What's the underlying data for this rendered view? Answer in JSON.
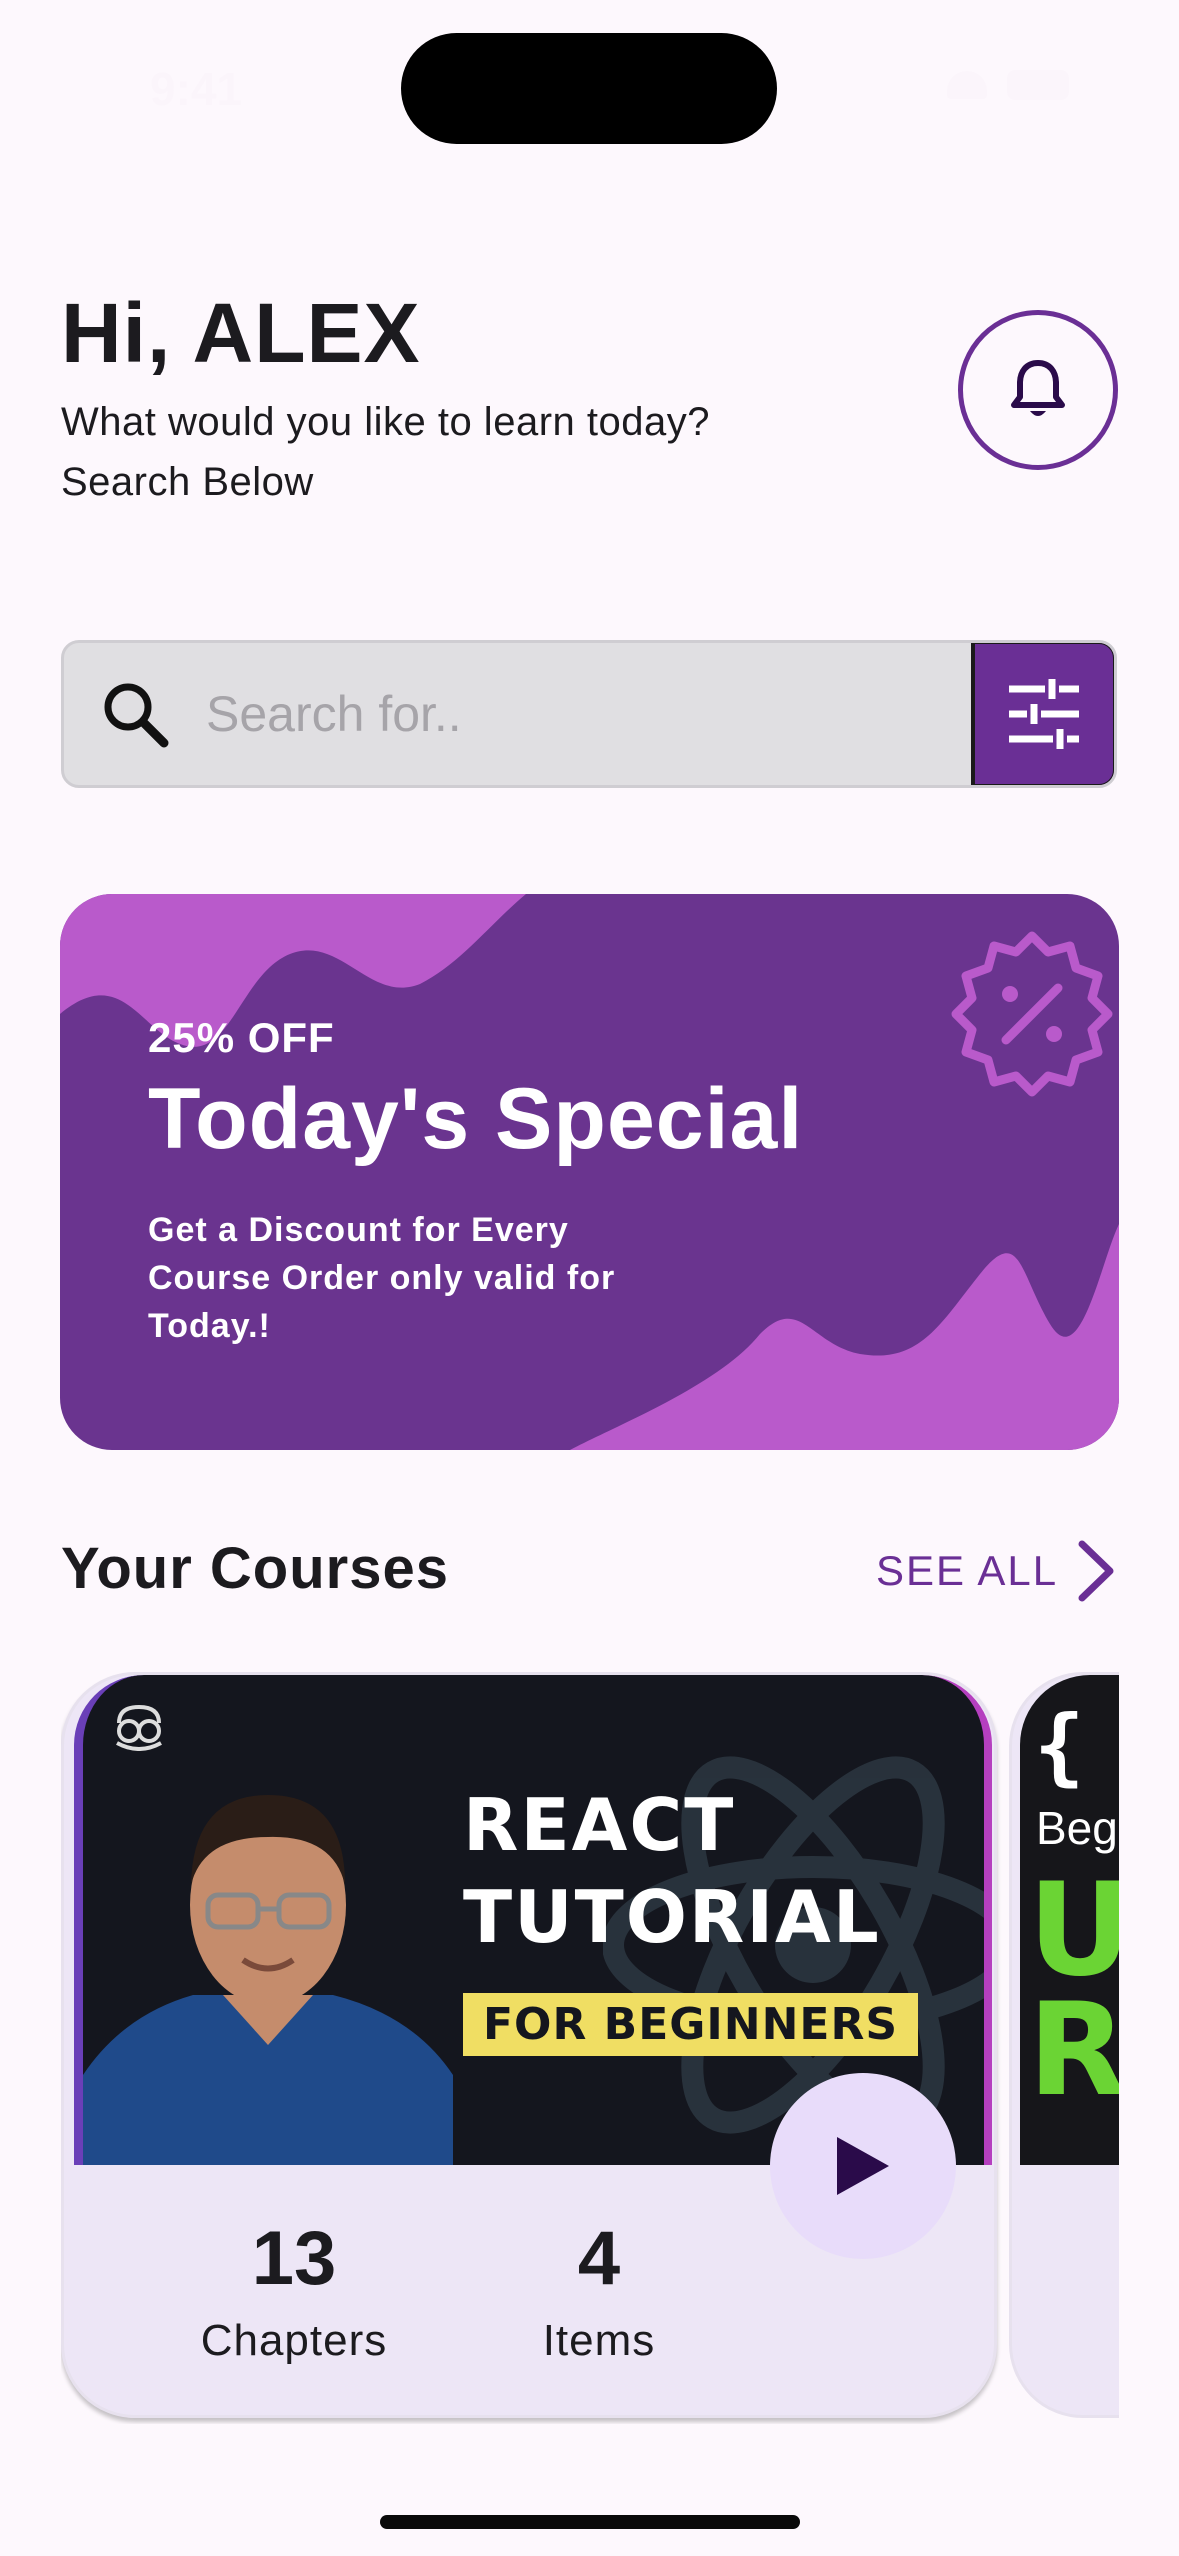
{
  "status_bar": {
    "time": "9:41"
  },
  "header": {
    "greeting": "Hi, ALEX",
    "subtitle_line1": "What would you like to learn today?",
    "subtitle_line2": "Search Below"
  },
  "search": {
    "placeholder": "Search for.."
  },
  "promo": {
    "badge": "25% OFF",
    "title": "Today's Special",
    "description": "Get a Discount for Every Course Order only valid for Today.!",
    "colors": {
      "background": "#6a348f",
      "wave": "#b95acb"
    }
  },
  "courses_section": {
    "title": "Your Courses",
    "see_all_label": "SEE ALL"
  },
  "courses": [
    {
      "thumbnail_line1": "REACT",
      "thumbnail_line2": "TUTORIAL",
      "thumbnail_tag": "FOR BEGINNERS",
      "chapters_value": "13",
      "chapters_label": "Chapters",
      "items_value": "4",
      "items_label": "Items"
    },
    {
      "thumbnail_brace": "{ J",
      "thumbnail_sub": "Begi",
      "thumbnail_big": "Ul\nRo"
    }
  ],
  "theme": {
    "accent": "#6a2f95",
    "background": "#fdf8fd"
  },
  "icons": [
    "bell-icon",
    "search-icon",
    "filter-icon",
    "discount-badge-icon",
    "play-icon",
    "chevron-right-icon"
  ]
}
